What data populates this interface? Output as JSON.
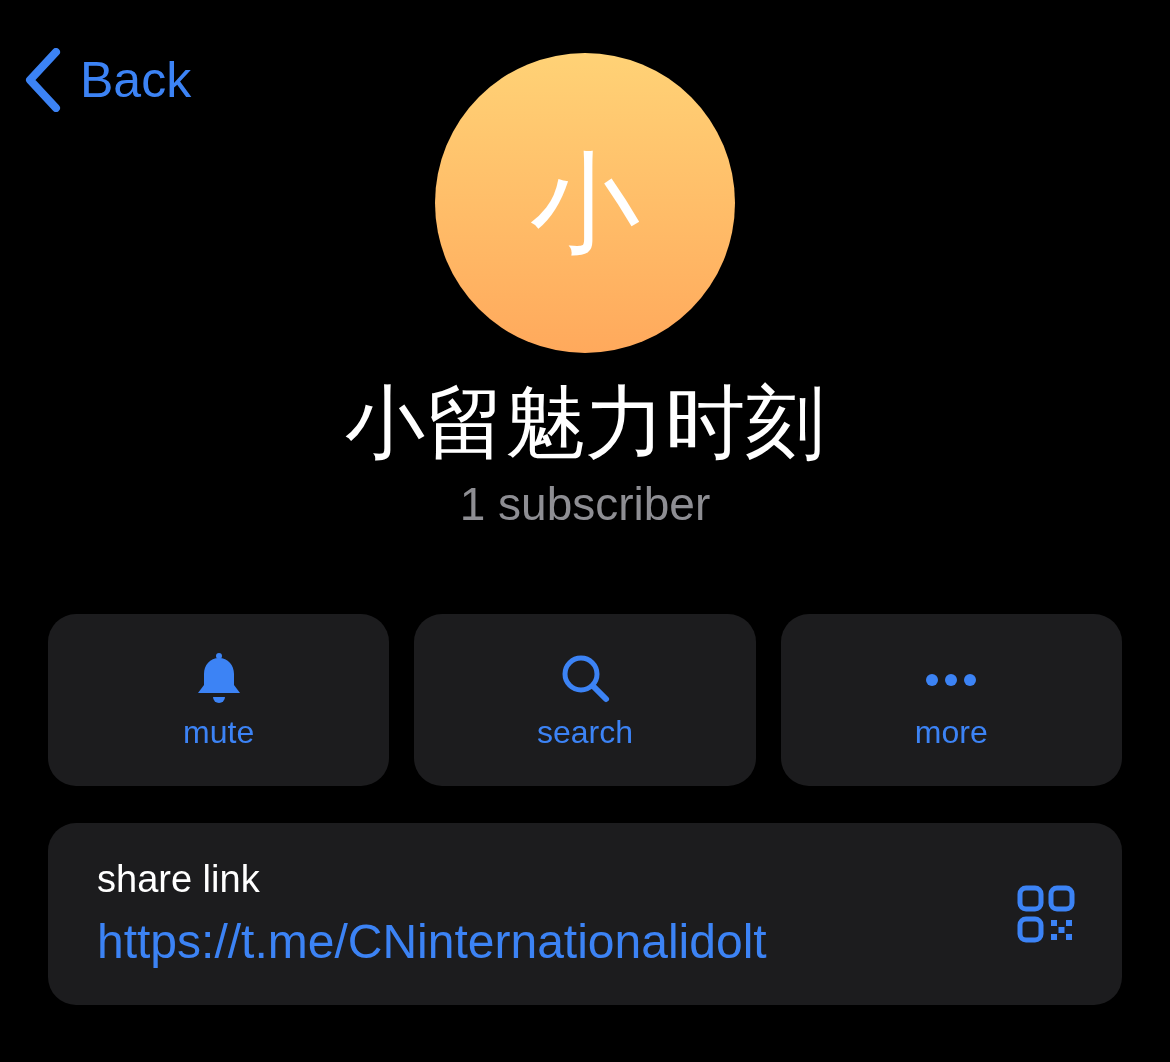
{
  "nav": {
    "back_label": "Back"
  },
  "channel": {
    "avatar_letter": "小",
    "name": "小留魅力时刻",
    "subtitle": "1 subscriber"
  },
  "actions": [
    {
      "kind": "mute",
      "label": "mute"
    },
    {
      "kind": "search",
      "label": "search"
    },
    {
      "kind": "more",
      "label": "more"
    }
  ],
  "share": {
    "label": "share link",
    "link": "https://t.me/CNinternationalidolt"
  }
}
